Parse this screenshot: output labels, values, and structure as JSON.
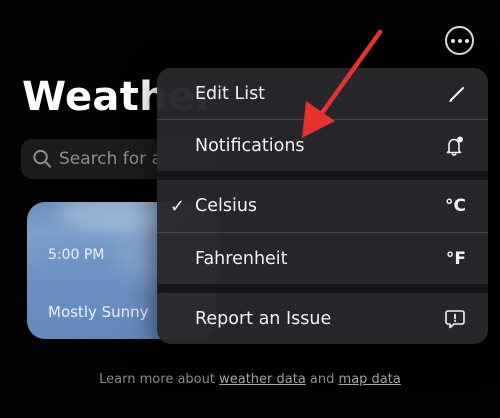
{
  "header": {
    "more_button_icon": "ellipsis-circle-icon"
  },
  "page": {
    "title": "Weather"
  },
  "search": {
    "placeholder": "Search for a"
  },
  "card": {
    "time": "5:00 PM",
    "condition": "Mostly Sunny"
  },
  "menu": {
    "edit_list": {
      "label": "Edit List",
      "icon": "pencil-icon"
    },
    "notifications": {
      "label": "Notifications",
      "icon": "bell-badge-icon"
    },
    "celsius": {
      "label": "Celsius",
      "unit": "°C",
      "checked": true
    },
    "fahrenheit": {
      "label": "Fahrenheit",
      "unit": "°F"
    },
    "report": {
      "label": "Report an Issue",
      "icon": "exclamation-bubble-icon"
    }
  },
  "footer": {
    "prefix": "Learn more about ",
    "weather_link": "weather data",
    "middle": " and ",
    "map_link": "map data"
  },
  "annotation": {
    "arrow_color": "#e8322f"
  }
}
